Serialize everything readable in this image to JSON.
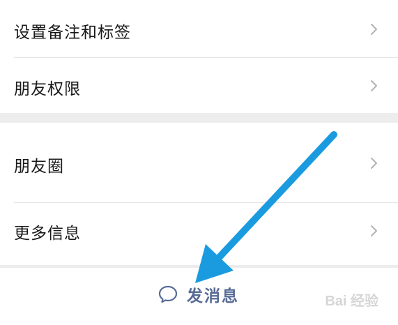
{
  "menu_group_1": {
    "items": [
      {
        "label": "设置备注和标签",
        "icon": "chevron-right-icon"
      },
      {
        "label": "朋友权限",
        "icon": "chevron-right-icon"
      }
    ]
  },
  "menu_group_2": {
    "items": [
      {
        "label": "朋友圈",
        "icon": "chevron-right-icon"
      },
      {
        "label": "更多信息",
        "icon": "chevron-right-icon"
      }
    ]
  },
  "bottom_action": {
    "label": "发消息",
    "icon": "chat-bubble-icon"
  },
  "annotation": {
    "type": "arrow",
    "color": "#1a9be0",
    "points_to": "send-message-button"
  },
  "watermark": {
    "text": "Bai 经验"
  },
  "colors": {
    "link_blue": "#576b95",
    "text_primary": "#191919",
    "background": "#ededed",
    "chevron": "#b2b2b2"
  }
}
